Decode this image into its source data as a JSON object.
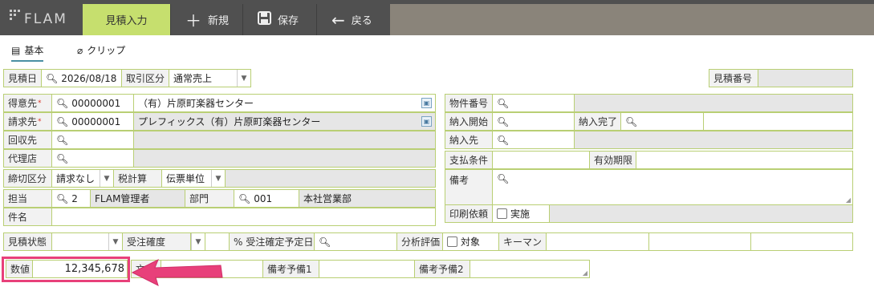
{
  "app": {
    "logo": "FLAM",
    "active_tab": "見積入力",
    "buttons": {
      "new": "新規",
      "save": "保存",
      "back": "戻る"
    }
  },
  "subtabs": {
    "basic": "基本",
    "clip": "クリップ"
  },
  "header": {
    "date_label": "見積日",
    "date_value": "2026/08/18",
    "type_label": "取引区分",
    "type_value": "通常売上",
    "number_label": "見積番号",
    "number_value": ""
  },
  "left": {
    "customer_label": "得意先",
    "customer_code": "00000001",
    "customer_name": "（有）片原町楽器センター",
    "billing_label": "請求先",
    "billing_code": "00000001",
    "billing_name": "プレフィックス（有）片原町楽器センター",
    "collect_label": "回収先",
    "agent_label": "代理店",
    "closing_label": "締切区分",
    "closing_value": "請求なし",
    "tax_label": "税計算",
    "tax_value": "伝票単位",
    "staff_label": "担当",
    "staff_code": "2",
    "staff_name": "FLAM管理者",
    "dept_label": "部門",
    "dept_code": "001",
    "dept_name": "本社営業部",
    "subject_label": "件名"
  },
  "right": {
    "property_label": "物件番号",
    "delivery_start_label": "納入開始",
    "delivery_end_label": "納入完了",
    "delivery_to_label": "納入先",
    "payment_label": "支払条件",
    "validity_label": "有効期限",
    "notes_label": "備考",
    "print_label": "印刷依頼",
    "print_check_label": "実施"
  },
  "status_row": {
    "estimate_status_label": "見積状態",
    "order_confidence_label": "受注確度",
    "percent": "%",
    "order_date_label": "受注確定予定日",
    "analysis_label": "分析評価",
    "analysis_check_label": "対象",
    "keyman_label": "キーマン"
  },
  "bottom_row": {
    "numeric_label": "数値",
    "numeric_value": "12,345,678",
    "partial_label": "文",
    "note1_label": "備考予備1",
    "note2_label": "備考予備2"
  },
  "colors": {
    "accent": "#c6df6e",
    "border": "#b9cf74",
    "highlight": "#e8407a"
  }
}
